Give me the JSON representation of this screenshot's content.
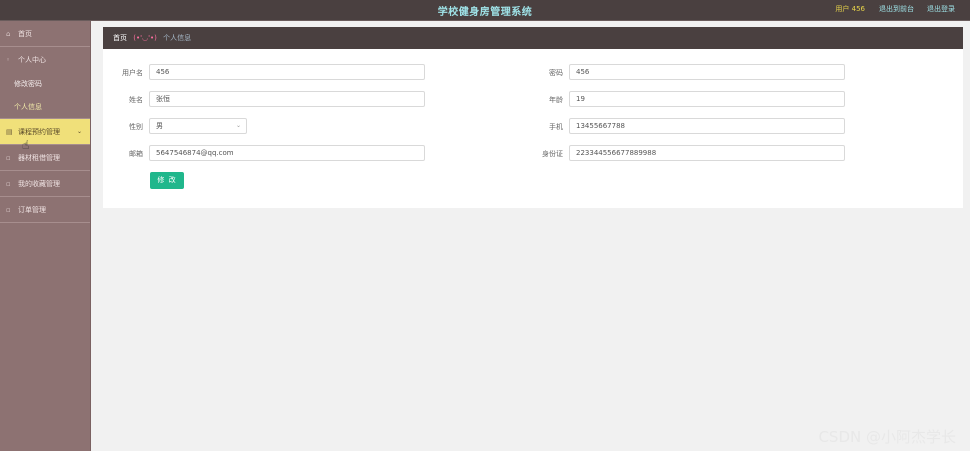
{
  "header": {
    "title": "学校健身房管理系统",
    "user_label": "用户 456",
    "back_link": "退出到前台",
    "logout_link": "退出登录"
  },
  "sidebar": {
    "home": "首页",
    "personal_center": "个人中心",
    "change_password": "修改密码",
    "personal_info": "个人信息",
    "course_booking": "课程预约管理",
    "equipment_rental": "器材租借管理",
    "my_favorites": "我的收藏管理",
    "orders": "订单管理"
  },
  "breadcrumb": {
    "home": "首页",
    "emoji": "(•'◡'•)",
    "current": "个人信息"
  },
  "form": {
    "username_label": "用户名",
    "username_value": "456",
    "password_label": "密码",
    "password_value": "456",
    "name_label": "姓名",
    "name_value": "张恒",
    "age_label": "年龄",
    "age_value": "19",
    "gender_label": "性别",
    "gender_value": "男",
    "phone_label": "手机",
    "phone_value": "13455667788",
    "email_label": "邮箱",
    "email_value": "5647546874@qq.com",
    "idcard_label": "身份证",
    "idcard_value": "223344556677889988",
    "submit_label": "修 改"
  },
  "watermark": "CSDN @小阿杰学长",
  "colors": {
    "topbar": "#4a4040",
    "sidebar": "#8d7272",
    "highlight": "#f0e07a",
    "button": "#20b78c"
  }
}
